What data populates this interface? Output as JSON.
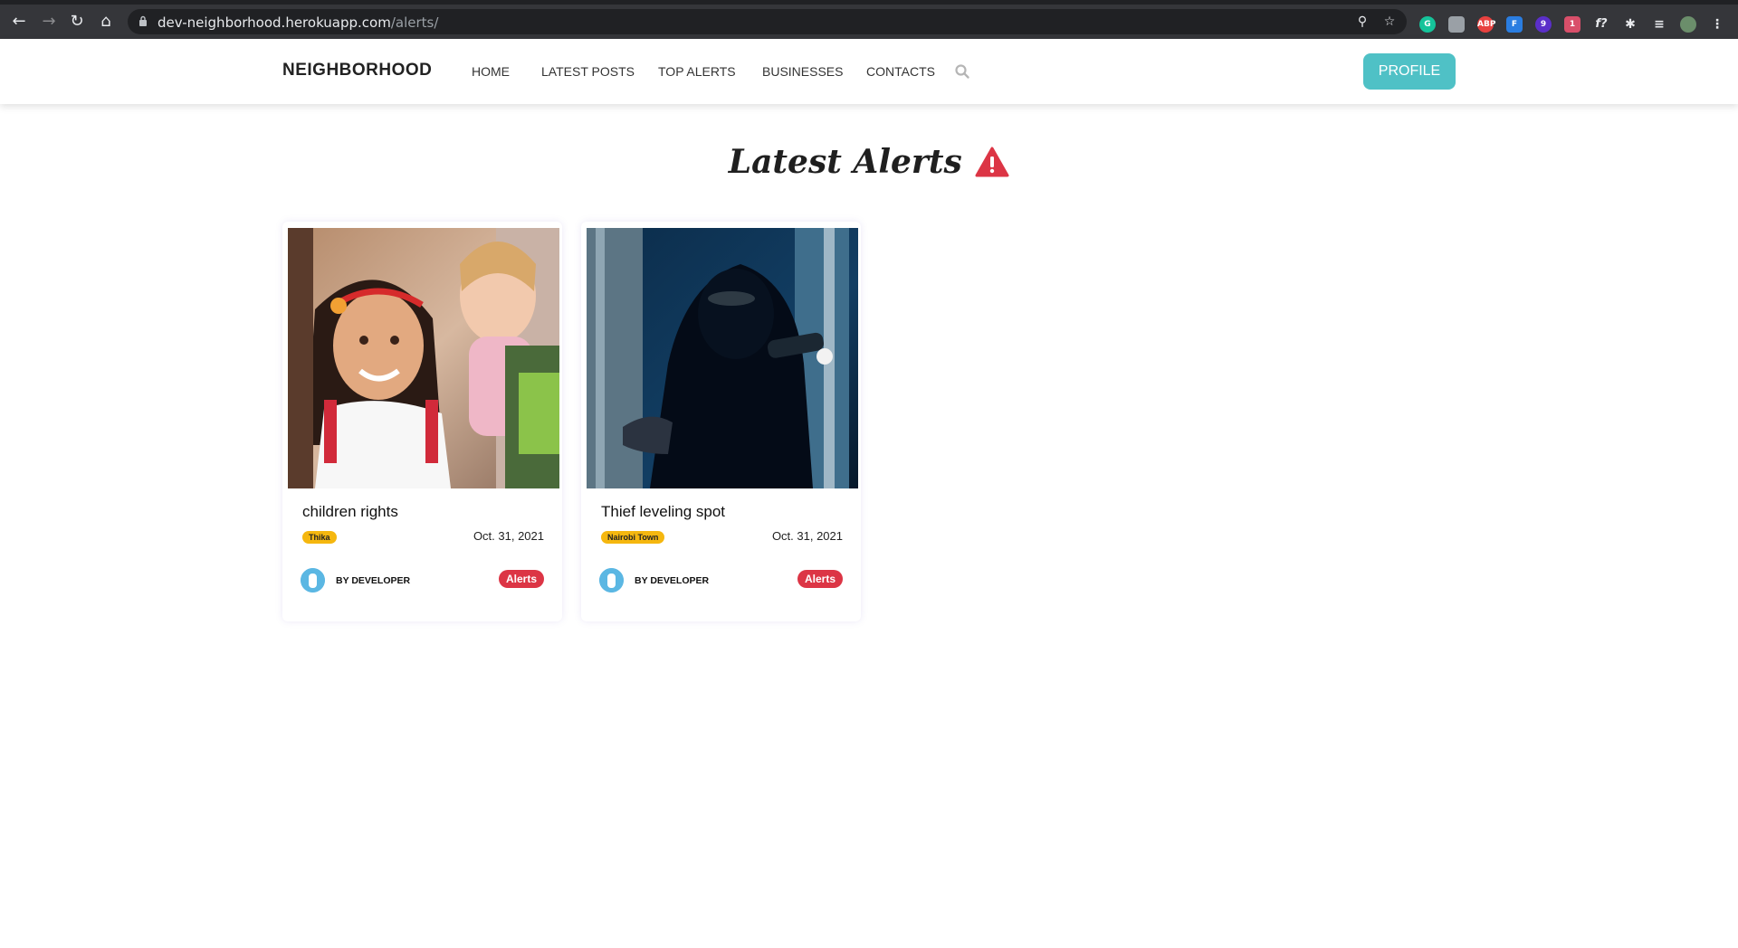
{
  "browser": {
    "url_host": "dev-neighborhood.herokuapp.com",
    "url_path": "/alerts/",
    "extension_badges": [
      "9",
      "1"
    ]
  },
  "nav": {
    "brand": "NEIGHBORHOOD",
    "links": [
      "HOME",
      "LATEST POSTS",
      "TOP ALERTS",
      "BUSINESSES",
      "CONTACTS"
    ],
    "profile_label": "PROFILE"
  },
  "page": {
    "title": "Latest Alerts"
  },
  "alerts": [
    {
      "title": "children rights",
      "location": "Thika",
      "date": "Oct. 31, 2021",
      "author": "BY DEVELOPER",
      "category": "Alerts"
    },
    {
      "title": "Thief leveling spot",
      "location": "Nairobi Town",
      "date": "Oct. 31, 2021",
      "author": "BY DEVELOPER",
      "category": "Alerts"
    }
  ],
  "colors": {
    "accent": "#4fc1c6",
    "danger": "#dc3545",
    "location_badge": "#f5b70f",
    "chrome_bg": "#35363a"
  }
}
